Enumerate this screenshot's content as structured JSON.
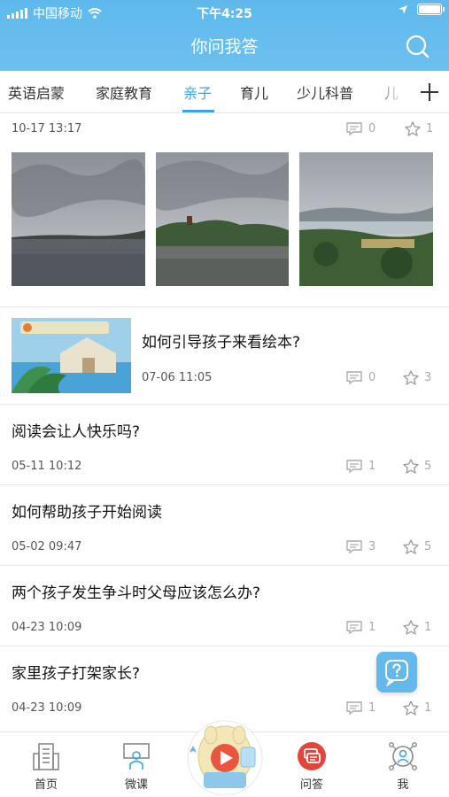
{
  "status": {
    "carrier": "中国移动",
    "time": "下午4:25"
  },
  "header": {
    "title": "你问我答"
  },
  "tabs": [
    {
      "label": "英语启蒙",
      "active": false
    },
    {
      "label": "家庭教育",
      "active": false
    },
    {
      "label": "亲子",
      "active": true
    },
    {
      "label": "育儿",
      "active": false
    },
    {
      "label": "少儿科普",
      "active": false
    },
    {
      "label": "儿",
      "active": false
    }
  ],
  "colors": {
    "header": "#6cc0ef",
    "accent": "#3aa5e3"
  },
  "posts": [
    {
      "kind": "gallery",
      "time": "10-17 13:17",
      "comments": "0",
      "favorites": "1"
    },
    {
      "kind": "thumb",
      "title": "如何引导孩子来看绘本?",
      "time": "07-06 11:05",
      "comments": "0",
      "favorites": "3"
    },
    {
      "kind": "text",
      "title": "阅读会让人快乐吗?",
      "time": "05-11 10:12",
      "comments": "1",
      "favorites": "5"
    },
    {
      "kind": "text",
      "title": "如何帮助孩子开始阅读",
      "time": "05-02 09:47",
      "comments": "3",
      "favorites": "5"
    },
    {
      "kind": "text",
      "title": "两个孩子发生争斗时父母应该怎么办?",
      "time": "04-23 10:09",
      "comments": "1",
      "favorites": "1"
    },
    {
      "kind": "text",
      "title": "家里孩子打架家长?",
      "time": "04-23 10:09",
      "comments": "1",
      "favorites": "1"
    }
  ],
  "nav": [
    {
      "label": "首页",
      "icon": "building-icon"
    },
    {
      "label": "微课",
      "icon": "microlesson-icon"
    },
    {
      "label": "问答",
      "icon": "qa-icon"
    },
    {
      "label": "我",
      "icon": "profile-icon"
    }
  ]
}
